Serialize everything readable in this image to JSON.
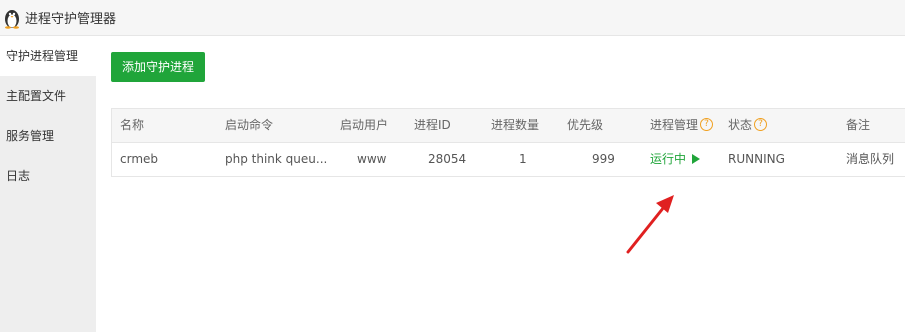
{
  "window": {
    "title": "进程守护管理器",
    "logo_icon": "penguin-icon"
  },
  "sidebar": {
    "items": [
      {
        "label": "守护进程管理",
        "active": true
      },
      {
        "label": "主配置文件",
        "active": false
      },
      {
        "label": "服务管理",
        "active": false
      },
      {
        "label": "日志",
        "active": false
      }
    ]
  },
  "toolbar": {
    "add_label": "添加守护进程"
  },
  "table": {
    "columns": [
      "名称",
      "启动命令",
      "启动用户",
      "进程ID",
      "进程数量",
      "优先级",
      "进程管理",
      "状态",
      "备注"
    ],
    "rows": [
      {
        "name": "crmeb",
        "command": "php think queu...",
        "user": "www",
        "pid": "28054",
        "count": "1",
        "priority": "999",
        "manage": "运行中",
        "status": "RUNNING",
        "note": "消息队列"
      }
    ]
  },
  "colors": {
    "accent": "#20a53a",
    "help": "#f0a020",
    "annotation_arrow": "#e02020"
  }
}
